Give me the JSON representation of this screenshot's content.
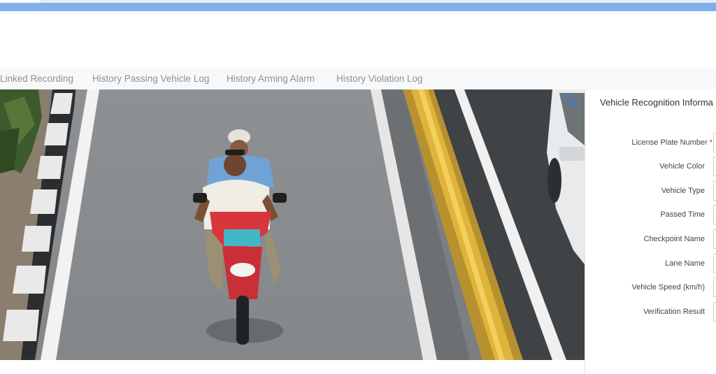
{
  "tabs": [
    {
      "label": "Linked Recording"
    },
    {
      "label": "History Passing Vehicle Log"
    },
    {
      "label": "History Arming Alarm"
    },
    {
      "label": "History Violation Log"
    }
  ],
  "snapshot": {
    "plate_overlay_color": "#43b7c6",
    "scooter_color": "#d8353c"
  },
  "panel": {
    "title": "Vehicle Recognition Informa",
    "fields": [
      {
        "label": "License Plate Number",
        "required": true,
        "required_mark": "*"
      },
      {
        "label": "Vehicle Color"
      },
      {
        "label": "Vehicle Type"
      },
      {
        "label": "Passed Time"
      },
      {
        "label": "Checkpoint Name"
      },
      {
        "label": "Lane Name"
      },
      {
        "label": "Vehicle Speed (km/h)"
      },
      {
        "label": "Verification Result"
      }
    ]
  },
  "colors": {
    "title_bar": "#7fb0ea",
    "tab_text": "#8d9296",
    "required": "#e0302d"
  },
  "icons": {
    "zoom": "magnifier-icon"
  }
}
